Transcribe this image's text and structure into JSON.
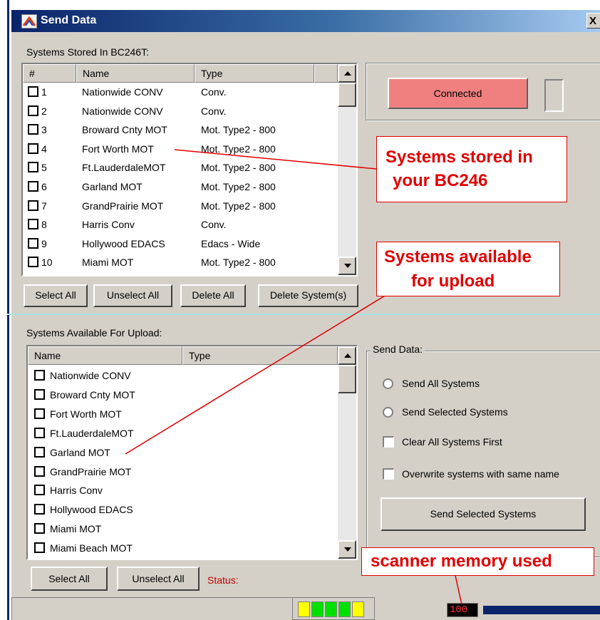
{
  "window": {
    "title": "Send Data",
    "close_label": "X"
  },
  "stored": {
    "label": "Systems Stored In BC246T:",
    "columns": [
      "#",
      "Name",
      "Type"
    ],
    "rows": [
      {
        "num": "1",
        "name": "Nationwide CONV",
        "type": "Conv."
      },
      {
        "num": "2",
        "name": "Nationwide CONV",
        "type": "Conv."
      },
      {
        "num": "3",
        "name": "Broward Cnty MOT",
        "type": "Mot. Type2 - 800"
      },
      {
        "num": "4",
        "name": "Fort Worth MOT",
        "type": "Mot. Type2 - 800"
      },
      {
        "num": "5",
        "name": "Ft.LauderdaleMOT",
        "type": "Mot. Type2 - 800"
      },
      {
        "num": "6",
        "name": "Garland MOT",
        "type": "Mot. Type2 - 800"
      },
      {
        "num": "7",
        "name": "GrandPrairie MOT",
        "type": "Mot. Type2 - 800"
      },
      {
        "num": "8",
        "name": "Harris Conv",
        "type": "Conv."
      },
      {
        "num": "9",
        "name": "Hollywood EDACS",
        "type": "Edacs - Wide"
      },
      {
        "num": "10",
        "name": "Miami MOT",
        "type": "Mot. Type2 - 800"
      }
    ],
    "buttons": {
      "select_all": "Select All",
      "unselect_all": "Unselect All",
      "delete_all": "Delete All",
      "delete_systems": "Delete System(s)"
    }
  },
  "connection": {
    "status_label": "Connected",
    "status_color": "#f08080"
  },
  "available": {
    "label": "Systems Available For Upload:",
    "columns": [
      "Name",
      "Type"
    ],
    "rows": [
      "Nationwide CONV",
      "Broward Cnty MOT",
      "Fort Worth MOT",
      "Ft.LauderdaleMOT",
      "Garland MOT",
      "GrandPrairie MOT",
      "Harris Conv",
      "Hollywood EDACS",
      "Miami MOT",
      "Miami Beach MOT"
    ],
    "buttons": {
      "select_all": "Select All",
      "unselect_all": "Unselect All"
    },
    "status_label": "Status:"
  },
  "send": {
    "group_label": "Send Data:",
    "radio_all": "Send All Systems",
    "radio_selected": "Send Selected Systems",
    "check_clear": "Clear All Systems First",
    "check_overwrite": "Overwrite systems with same name",
    "send_button": "Send Selected Systems"
  },
  "annotations": {
    "stored_line1": "Systems stored in",
    "stored_line2": "your BC246",
    "available_line1": "Systems available",
    "available_line2": "for upload",
    "memory": "scanner memory used",
    "color": "#e00000"
  },
  "statusbar": {
    "memory_value": "100",
    "memory_fraction": 1.0
  }
}
